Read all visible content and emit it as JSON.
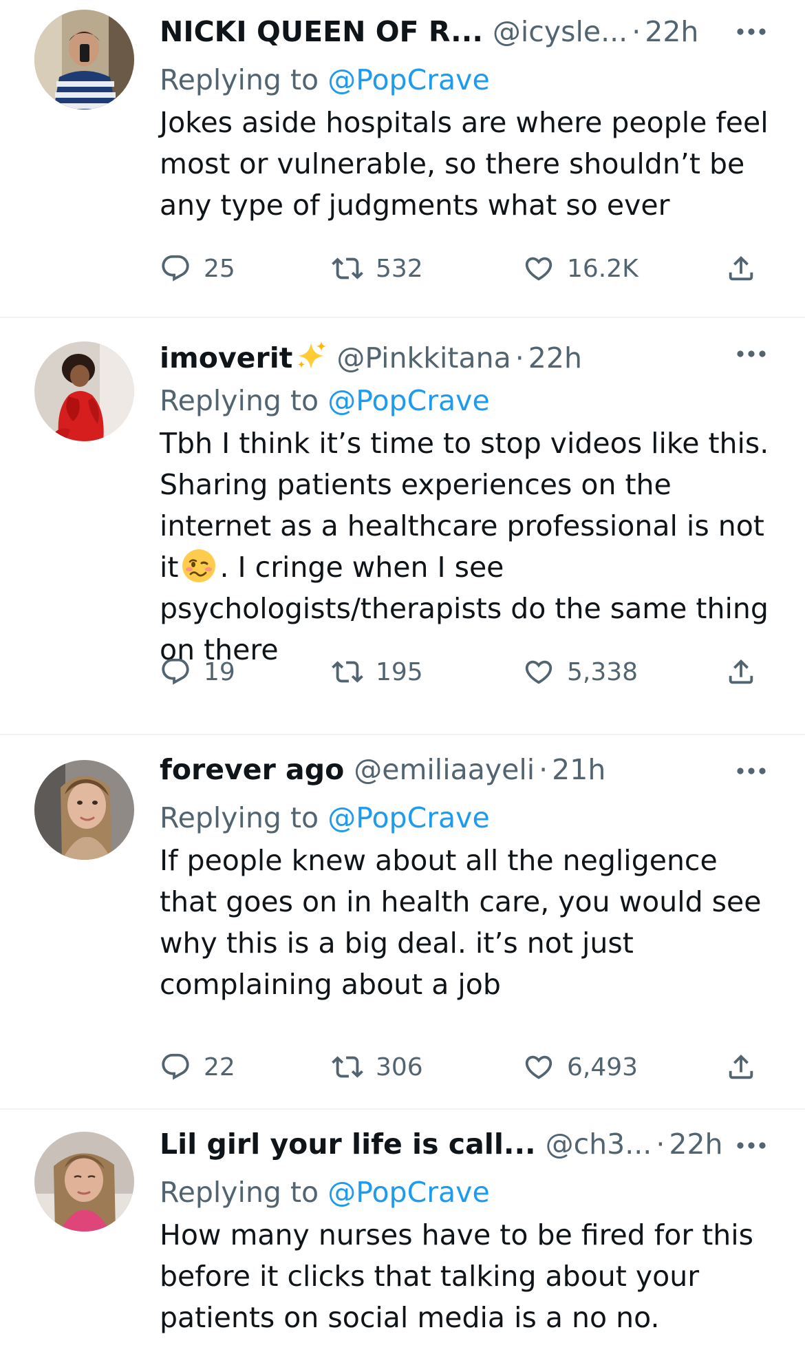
{
  "tweets": [
    {
      "name": "NICKI QUEEN OF R...",
      "handle": "@icysle...",
      "separator": "·",
      "time": "22h",
      "replying_prefix": "Replying to",
      "replying_to": "@PopCrave",
      "text": "Jokes aside hospitals are where people feel most or vulnerable, so there shouldn’t be any type of judgments what so ever",
      "replies": "25",
      "retweets": "532",
      "likes": "16.2K"
    },
    {
      "name": "imoverit",
      "name_emoji": "sparkles-emoji",
      "handle": "@Pinkkitana",
      "separator": "·",
      "time": "22h",
      "replying_prefix": "Replying to",
      "replying_to": "@PopCrave",
      "text_before_emoji": "Tbh I think it’s time to stop videos like this. Sharing patients experiences on the internet as a healthcare professional is not it",
      "inline_emoji": "woozy-face-emoji",
      "text_after_emoji": ". I cringe when I see psychologists/therapists do the same thing on there",
      "replies": "19",
      "retweets": "195",
      "likes": "5,338"
    },
    {
      "name": "forever ago",
      "handle": "@emiliaayeli",
      "separator": "·",
      "time": "21h",
      "replying_prefix": "Replying to",
      "replying_to": "@PopCrave",
      "text": "If people knew about all the negligence that goes on in health care,  you would see why this is a big deal. it’s not just complaining about a job",
      "replies": "22",
      "retweets": "306",
      "likes": "6,493"
    },
    {
      "name": "Lil girl your life is call...",
      "handle": "@ch3...",
      "separator": "·",
      "time": "22h",
      "replying_prefix": "Replying to",
      "replying_to": "@PopCrave",
      "text": "How many nurses have to be fired for this before it clicks that talking about your patients on social media is a no no."
    }
  ],
  "icons": {
    "reply": "reply-icon",
    "retweet": "retweet-icon",
    "like": "heart-icon",
    "share": "share-icon",
    "more": "more-options-icon"
  },
  "colors": {
    "text": "#0f1419",
    "secondary": "#536471",
    "link": "#1d9bf0",
    "divider": "#eff3f4"
  }
}
